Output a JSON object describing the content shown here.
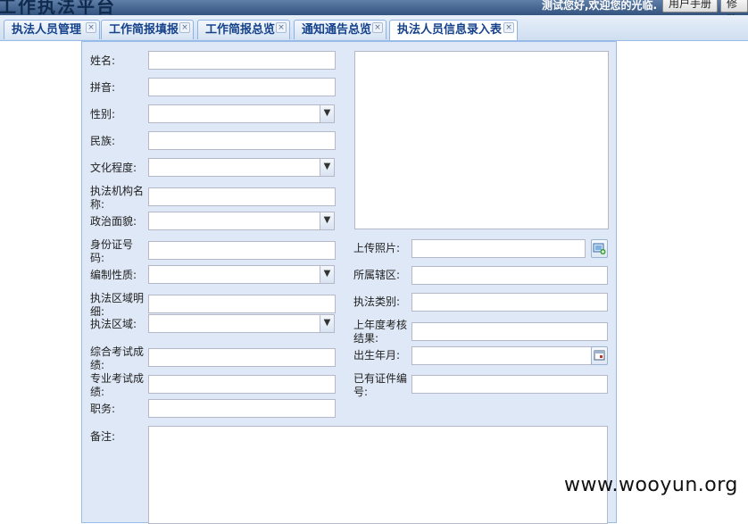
{
  "header": {
    "logo_fragment": "工作执法平台",
    "welcome_text": "测试您好,欢迎您的光临.",
    "buttons": [
      "用户手册",
      "修改"
    ]
  },
  "tabs": [
    {
      "label": "执法人员管理",
      "active": false
    },
    {
      "label": "工作简报填报",
      "active": false
    },
    {
      "label": "工作简报总览",
      "active": false
    },
    {
      "label": "通知通告总览",
      "active": false
    },
    {
      "label": "执法人员信息录入表",
      "active": true
    }
  ],
  "form": {
    "left": {
      "name": "姓名:",
      "pinyin": "拼音:",
      "gender": "性别:",
      "ethnicity": "民族:",
      "education": "文化程度:",
      "agency_name": "执法机构名称:",
      "political_status": "政治面貌:",
      "id_number": "身份证号码:",
      "staffing_type": "编制性质:",
      "area_detail": "执法区域明细:",
      "area": "执法区域:",
      "general_exam": "综合考试成绩:",
      "professional_exam": "专业考试成绩:",
      "position": "职务:",
      "remarks": "备注:"
    },
    "right": {
      "upload_photo": "上传照片:",
      "district": "所属辖区:",
      "enforcement_type": "执法类别:",
      "last_year_assessment": "上年度考核结果:",
      "birth_month": "出生年月:",
      "existing_cert_no": "已有证件编号:"
    }
  },
  "watermark": "www.wooyun.org",
  "colors": {
    "header_bg": "#3b5b86",
    "tab_text": "#15428b",
    "panel_bg": "#dfe8f6",
    "panel_border": "#99bbe8"
  },
  "icons": {
    "combo": "chevron-down-icon",
    "upload": "image-add-icon",
    "date": "calendar-icon"
  }
}
